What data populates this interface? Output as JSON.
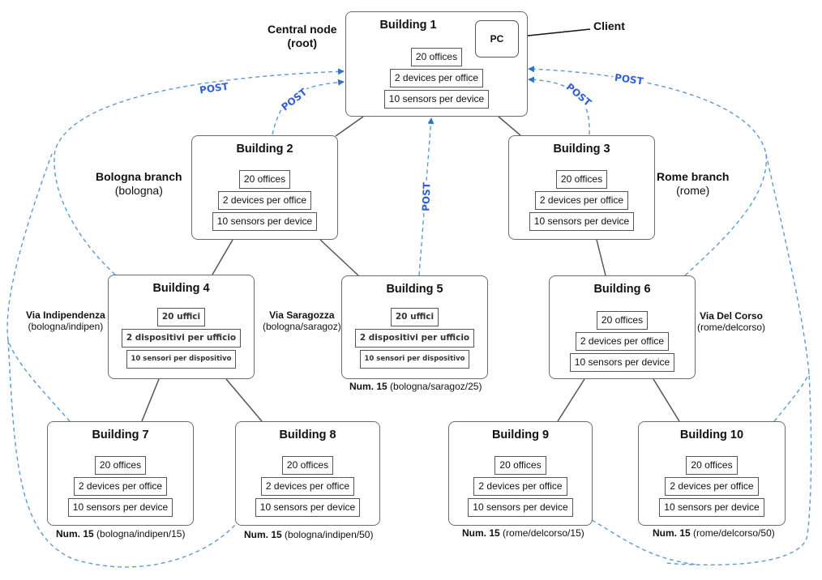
{
  "colors": {
    "post_link": "#5b9bd5",
    "post_text": "#2f5fdc",
    "tree_line": "#555555",
    "border": "#6b6b6b"
  },
  "root_label": {
    "title": "Central node",
    "subtitle": "(root)"
  },
  "client_label": "Client",
  "pc_label": "PC",
  "post_label": "POST",
  "buildings": [
    {
      "id": "b1",
      "title": "Building 1",
      "specs": [
        "20 offices",
        "2 devices per office",
        "10 sensors per device"
      ]
    },
    {
      "id": "b2",
      "title": "Building 2",
      "specs": [
        "20 offices",
        "2 devices per office",
        "10 sensors per device"
      ]
    },
    {
      "id": "b3",
      "title": "Building 3",
      "specs": [
        "20 offices",
        "2 devices per office",
        "10 sensors per device"
      ]
    },
    {
      "id": "b4",
      "title": "Building 4",
      "specs": [
        "20 uffici",
        "2 dispositivi per ufficio",
        "10 sensori per dispositivo"
      ]
    },
    {
      "id": "b5",
      "title": "Building 5",
      "specs": [
        "20 uffici",
        "2 dispositivi per ufficio",
        "10 sensori per dispositivo"
      ]
    },
    {
      "id": "b6",
      "title": "Building 6",
      "specs": [
        "20 offices",
        "2 devices per office",
        "10 sensors per device"
      ]
    },
    {
      "id": "b7",
      "title": "Building 7",
      "specs": [
        "20 offices",
        "2 devices per office",
        "10 sensors per device"
      ]
    },
    {
      "id": "b8",
      "title": "Building 8",
      "specs": [
        "20 offices",
        "2 devices per office",
        "10 sensors per device"
      ]
    },
    {
      "id": "b9",
      "title": "Building 9",
      "specs": [
        "20 offices",
        "2 devices per office",
        "10 sensors per device"
      ]
    },
    {
      "id": "b10",
      "title": "Building 10",
      "specs": [
        "20 offices",
        "2 devices per office",
        "10 sensors per device"
      ]
    }
  ],
  "branches": {
    "bologna": {
      "title": "Bologna branch",
      "path": "(bologna)"
    },
    "rome": {
      "title": "Rome branch",
      "path": "(rome)"
    },
    "indipendenza": {
      "title": "Via Indipendenza",
      "path": "(bologna/indipen)"
    },
    "saragozza": {
      "title": "Via Saragozza",
      "path": "(bologna/saragoz)"
    },
    "delcorso": {
      "title": "Via Del Corso",
      "path": "(rome/delcorso)"
    }
  },
  "street_numbers": {
    "b5": {
      "label": "Num. 15",
      "path": "(bologna/saragoz/25)"
    },
    "b7": {
      "label": "Num. 15",
      "path": "(bologna/indipen/15)"
    },
    "b8": {
      "label": "Num. 15",
      "path": "(bologna/indipen/50)"
    },
    "b9": {
      "label": "Num. 15",
      "path": "(rome/delcorso/15)"
    },
    "b10": {
      "label": "Num. 15",
      "path": "(rome/delcorso/50)"
    }
  },
  "edges": [
    [
      "b1",
      "b2"
    ],
    [
      "b1",
      "b3"
    ],
    [
      "b2",
      "b4"
    ],
    [
      "b2",
      "b5"
    ],
    [
      "b3",
      "b6"
    ],
    [
      "b4",
      "b7"
    ],
    [
      "b4",
      "b8"
    ],
    [
      "b6",
      "b9"
    ],
    [
      "b6",
      "b10"
    ]
  ]
}
